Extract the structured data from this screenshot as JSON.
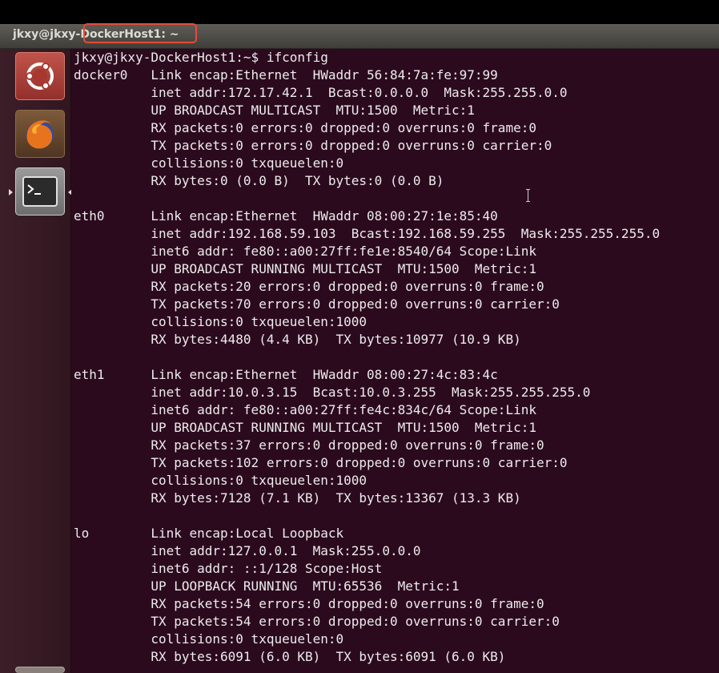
{
  "window": {
    "title": "jkxy@jkxy-DockerHost1: ~"
  },
  "launcher": {
    "items": [
      {
        "name": "Ubuntu Dash",
        "icon": "ubuntu-logo-icon"
      },
      {
        "name": "Firefox",
        "icon": "firefox-icon"
      },
      {
        "name": "Terminal",
        "icon": "terminal-icon",
        "active": true
      }
    ]
  },
  "terminal": {
    "prompt": "jkxy@jkxy-DockerHost1:~$ ifconfig",
    "output": "docker0   Link encap:Ethernet  HWaddr 56:84:7a:fe:97:99\n          inet addr:172.17.42.1  Bcast:0.0.0.0  Mask:255.255.0.0\n          UP BROADCAST MULTICAST  MTU:1500  Metric:1\n          RX packets:0 errors:0 dropped:0 overruns:0 frame:0\n          TX packets:0 errors:0 dropped:0 overruns:0 carrier:0\n          collisions:0 txqueuelen:0\n          RX bytes:0 (0.0 B)  TX bytes:0 (0.0 B)\n\neth0      Link encap:Ethernet  HWaddr 08:00:27:1e:85:40\n          inet addr:192.168.59.103  Bcast:192.168.59.255  Mask:255.255.255.0\n          inet6 addr: fe80::a00:27ff:fe1e:8540/64 Scope:Link\n          UP BROADCAST RUNNING MULTICAST  MTU:1500  Metric:1\n          RX packets:20 errors:0 dropped:0 overruns:0 frame:0\n          TX packets:70 errors:0 dropped:0 overruns:0 carrier:0\n          collisions:0 txqueuelen:1000\n          RX bytes:4480 (4.4 KB)  TX bytes:10977 (10.9 KB)\n\neth1      Link encap:Ethernet  HWaddr 08:00:27:4c:83:4c\n          inet addr:10.0.3.15  Bcast:10.0.3.255  Mask:255.255.255.0\n          inet6 addr: fe80::a00:27ff:fe4c:834c/64 Scope:Link\n          UP BROADCAST RUNNING MULTICAST  MTU:1500  Metric:1\n          RX packets:37 errors:0 dropped:0 overruns:0 frame:0\n          TX packets:102 errors:0 dropped:0 overruns:0 carrier:0\n          collisions:0 txqueuelen:1000\n          RX bytes:7128 (7.1 KB)  TX bytes:13367 (13.3 KB)\n\nlo        Link encap:Local Loopback\n          inet addr:127.0.0.1  Mask:255.0.0.0\n          inet6 addr: ::1/128 Scope:Host\n          UP LOOPBACK RUNNING  MTU:65536  Metric:1\n          RX packets:54 errors:0 dropped:0 overruns:0 frame:0\n          TX packets:54 errors:0 dropped:0 overruns:0 carrier:0\n          collisions:0 txqueuelen:0\n          RX bytes:6091 (6.0 KB)  TX bytes:6091 (6.0 KB)"
  },
  "colors": {
    "terminal_bg": "#2c0a1e",
    "terminal_fg": "#ececec",
    "launcher_bg": "#3a1d27",
    "highlight": "#e84a3a"
  }
}
